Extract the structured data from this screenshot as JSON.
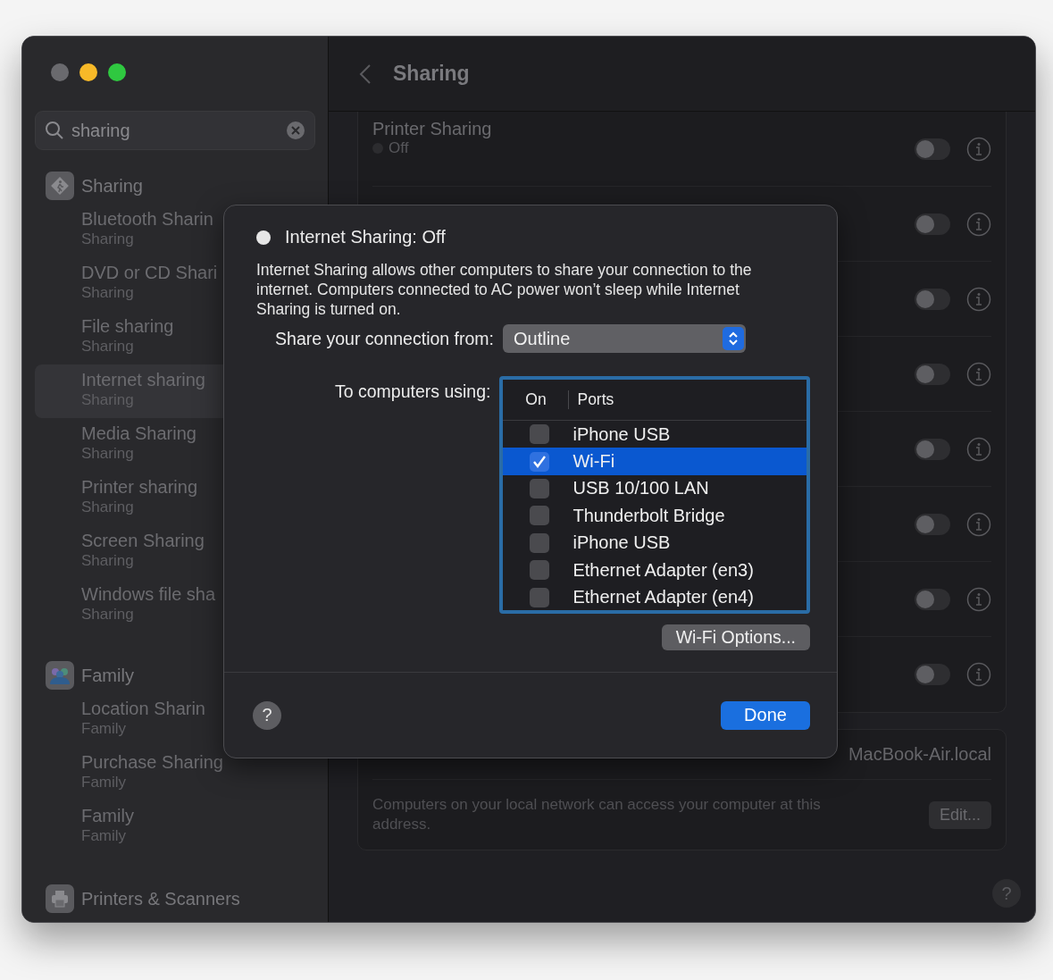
{
  "search": {
    "value": "sharing"
  },
  "sidebar": {
    "groups": [
      {
        "kind": "sharing",
        "title": "Sharing",
        "items": [
          {
            "title": "Bluetooth Sharin",
            "subtitle": "Sharing",
            "selected": false
          },
          {
            "title": "DVD or CD Shari",
            "subtitle": "Sharing",
            "selected": false
          },
          {
            "title": "File sharing",
            "subtitle": "Sharing",
            "selected": false
          },
          {
            "title": "Internet sharing",
            "subtitle": "Sharing",
            "selected": true
          },
          {
            "title": "Media Sharing",
            "subtitle": "Sharing",
            "selected": false
          },
          {
            "title": "Printer sharing",
            "subtitle": "Sharing",
            "selected": false
          },
          {
            "title": "Screen Sharing",
            "subtitle": "Sharing",
            "selected": false
          },
          {
            "title": "Windows file sha",
            "subtitle": "Sharing",
            "selected": false
          }
        ]
      },
      {
        "kind": "family",
        "title": "Family",
        "items": [
          {
            "title": "Location Sharin",
            "subtitle": "Family",
            "selected": false
          },
          {
            "title": "Purchase Sharing",
            "subtitle": "Family",
            "selected": false
          },
          {
            "title": "Family",
            "subtitle": "Family",
            "selected": false
          }
        ]
      },
      {
        "kind": "printers",
        "title": "Printers & Scanners"
      }
    ]
  },
  "header": {
    "title": "Sharing"
  },
  "services": [
    {
      "title": "Printer Sharing",
      "status": "Off",
      "on": false
    },
    {
      "on": false
    },
    {
      "on": false
    },
    {
      "on": false
    },
    {
      "on": false
    },
    {
      "on": false
    },
    {
      "on": false
    },
    {
      "on": false
    }
  ],
  "hostname": {
    "value": "MacBook-Air.local",
    "description": "Computers on your local network can access your computer at this address.",
    "button": "Edit..."
  },
  "dialog": {
    "title": "Internet Sharing: Off",
    "on": false,
    "description": "Internet Sharing allows other computers to share your connection to the internet. Computers connected to AC power won’t sleep while Internet Sharing is turned on.",
    "from_label": "Share your connection from:",
    "from_value": "Outline",
    "to_label": "To computers using:",
    "columns": [
      "On",
      "Ports"
    ],
    "ports": [
      {
        "port": "iPhone USB",
        "on": false,
        "selected": false
      },
      {
        "port": "Wi-Fi",
        "on": true,
        "selected": true
      },
      {
        "port": "USB 10/100 LAN",
        "on": false,
        "selected": false
      },
      {
        "port": "Thunderbolt Bridge",
        "on": false,
        "selected": false
      },
      {
        "port": "iPhone USB",
        "on": false,
        "selected": false
      },
      {
        "port": "Ethernet Adapter (en3)",
        "on": false,
        "selected": false
      },
      {
        "port": "Ethernet Adapter (en4)",
        "on": false,
        "selected": false
      }
    ],
    "options_button": "Wi-Fi Options...",
    "help": "?",
    "done_button": "Done"
  },
  "help": "?"
}
